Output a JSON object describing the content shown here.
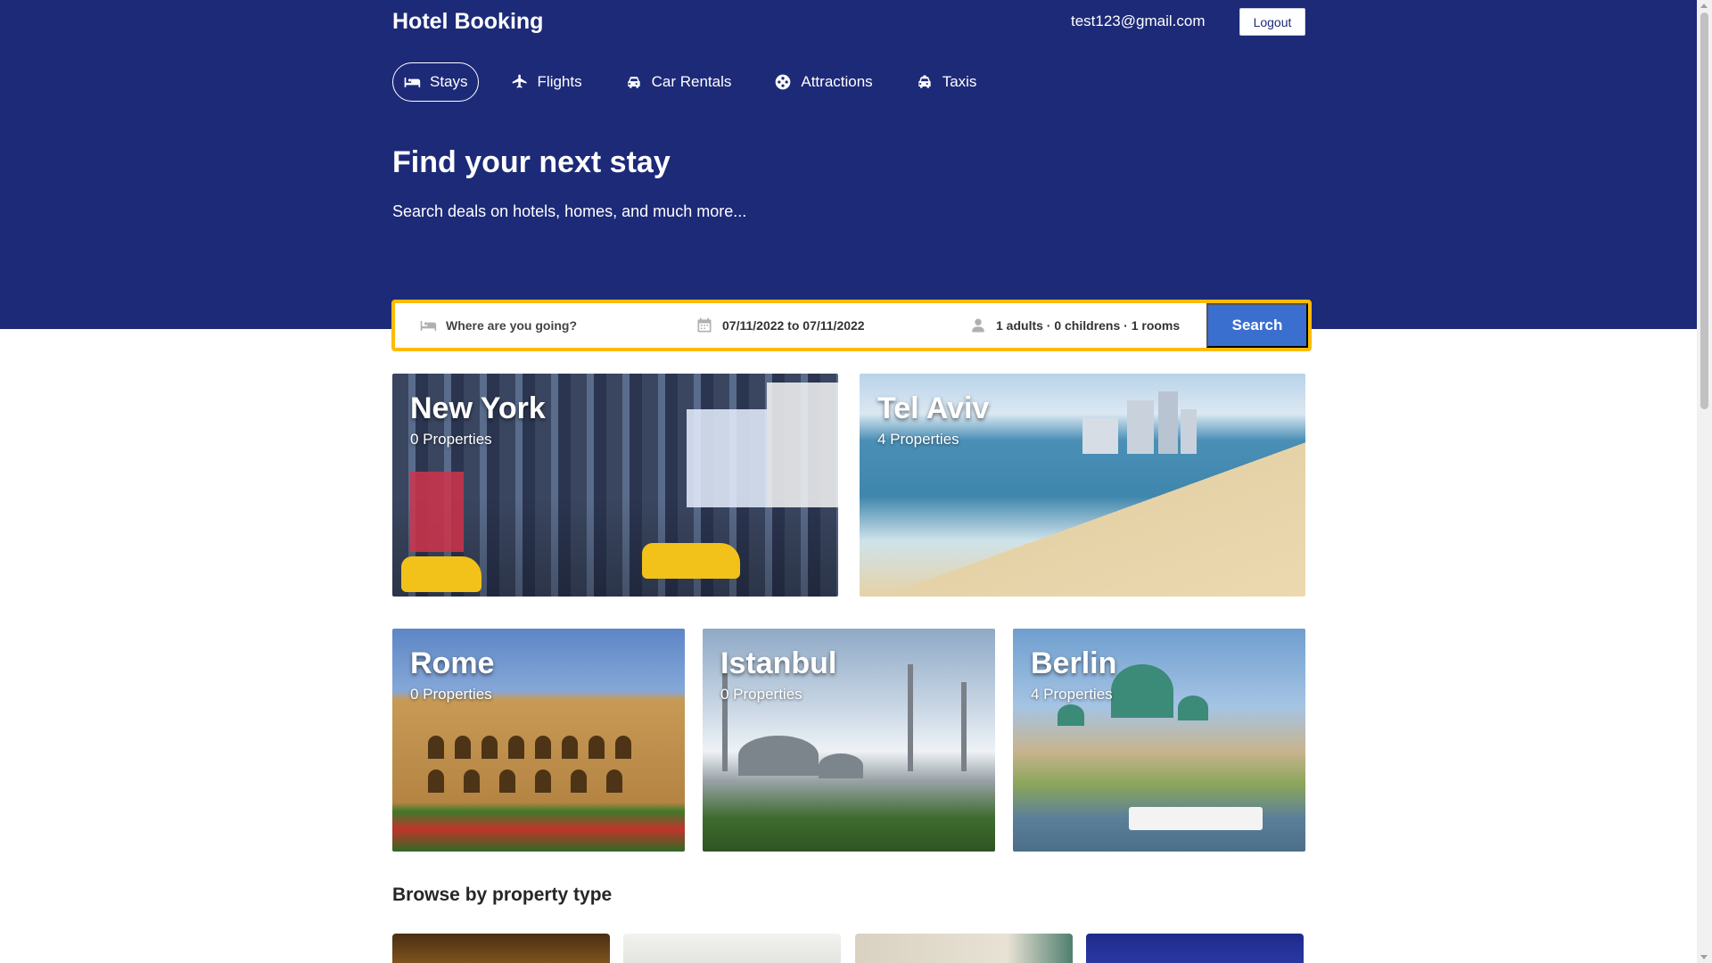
{
  "header": {
    "brand": "Hotel Booking",
    "user_email": "test123@gmail.com",
    "logout_label": "Logout"
  },
  "nav": {
    "items": [
      {
        "label": "Stays",
        "icon": "bed-icon",
        "active": true
      },
      {
        "label": "Flights",
        "icon": "plane-icon",
        "active": false
      },
      {
        "label": "Car Rentals",
        "icon": "car-icon",
        "active": false
      },
      {
        "label": "Attractions",
        "icon": "attraction-icon",
        "active": false
      },
      {
        "label": "Taxis",
        "icon": "taxi-icon",
        "active": false
      }
    ]
  },
  "hero": {
    "title": "Find your next stay",
    "subtitle": "Search deals on hotels, homes, and much more..."
  },
  "search": {
    "destination_placeholder": "Where are you going?",
    "dates": "07/11/2022 to 07/11/2022",
    "guests": "1 adults · 0 childrens · 1 rooms",
    "button_label": "Search"
  },
  "featured": [
    {
      "name": "New York",
      "properties": "0 Properties"
    },
    {
      "name": "Tel Aviv",
      "properties": "4 Properties"
    },
    {
      "name": "Rome",
      "properties": "0 Properties"
    },
    {
      "name": "Istanbul",
      "properties": "0 Properties"
    },
    {
      "name": "Berlin",
      "properties": "4 Properties"
    }
  ],
  "property_types": {
    "title": "Browse by property type"
  },
  "colors": {
    "header_bg": "#1d2a78",
    "search_border": "#febb02",
    "search_button": "#3b6fcf"
  }
}
